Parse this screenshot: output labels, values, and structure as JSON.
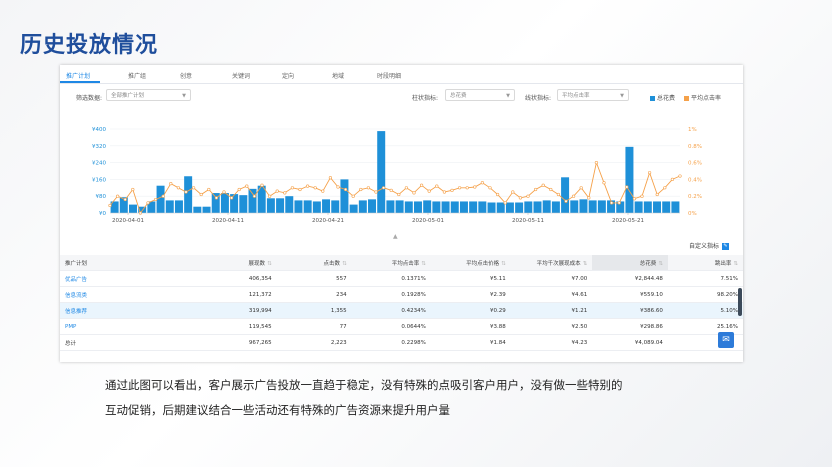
{
  "slide_title": "历史投放情况",
  "tabs": [
    "推广计划",
    "推广组",
    "创意",
    "关键词",
    "定向",
    "地域",
    "时段明细"
  ],
  "filters": {
    "filter_label": "筛选数据:",
    "filter_value": "全部推广计划",
    "bar_metric_label": "柱状指标:",
    "bar_metric_value": "总花费",
    "line_metric_label": "线状指标:",
    "line_metric_value": "平均点击率"
  },
  "legend": [
    {
      "label": "总花费",
      "color": "#1e90d8"
    },
    {
      "label": "平均点击率",
      "color": "#f5a14a"
    }
  ],
  "chart_data": {
    "type": "bar",
    "left_axis_ticks": [
      "¥400",
      "¥320",
      "¥240",
      "¥160",
      "¥80",
      "¥0"
    ],
    "right_axis_ticks": [
      "1%",
      "0.8%",
      "0.6%",
      "0.4%",
      "0.2%",
      "0%"
    ],
    "x_tick_labels": [
      "2020-04-01",
      "2020-04-11",
      "2020-04-21",
      "2020-05-01",
      "2020-05-11",
      "2020-05-21"
    ],
    "ylim_left": [
      0,
      400
    ],
    "ylim_right": [
      0,
      1
    ],
    "series": [
      {
        "name": "总花费",
        "type": "bar",
        "color": "#1e90d8",
        "values": [
          55,
          75,
          40,
          30,
          55,
          130,
          60,
          60,
          175,
          30,
          30,
          95,
          95,
          90,
          85,
          115,
          130,
          70,
          70,
          80,
          60,
          60,
          55,
          65,
          60,
          160,
          40,
          60,
          65,
          390,
          60,
          60,
          55,
          55,
          60,
          55,
          55,
          55,
          55,
          55,
          55,
          50,
          50,
          50,
          50,
          55,
          55,
          60,
          55,
          170,
          60,
          65,
          60,
          60,
          60,
          55,
          315,
          55,
          55,
          55,
          55,
          55
        ]
      },
      {
        "name": "平均点击率",
        "type": "line",
        "color": "#f5a14a",
        "values": [
          0.09,
          0.2,
          0.16,
          0.28,
          0.0,
          0.12,
          0.16,
          0.2,
          0.35,
          0.3,
          0.25,
          0.3,
          0.22,
          0.28,
          0.18,
          0.25,
          0.18,
          0.28,
          0.32,
          0.2,
          0.33,
          0.2,
          0.26,
          0.24,
          0.3,
          0.28,
          0.32,
          0.3,
          0.26,
          0.42,
          0.31,
          0.28,
          0.2,
          0.28,
          0.3,
          0.25,
          0.3,
          0.27,
          0.22,
          0.3,
          0.24,
          0.33,
          0.26,
          0.32,
          0.25,
          0.27,
          0.3,
          0.3,
          0.31,
          0.36,
          0.3,
          0.22,
          0.12,
          0.25,
          0.18,
          0.2,
          0.28,
          0.33,
          0.28,
          0.22,
          0.14,
          0.2,
          0.3,
          0.18,
          0.6,
          0.36,
          0.12,
          0.12,
          0.31,
          0.17,
          0.2,
          0.48,
          0.22,
          0.3,
          0.4,
          0.44
        ]
      }
    ]
  },
  "custom_metric_label": "自定义指标",
  "table": {
    "columns": [
      "推广计划",
      "展现数",
      "点击数",
      "平均点击率",
      "平均点击价格",
      "平均千次展现成本",
      "总花费",
      "跳出率"
    ],
    "rows": [
      [
        "优品广告",
        "406,354",
        "557",
        "0.1371%",
        "¥5.11",
        "¥7.00",
        "¥2,844.48",
        "7.51%"
      ],
      [
        "信息流类",
        "121,372",
        "234",
        "0.1928%",
        "¥2.39",
        "¥4.61",
        "¥559.10",
        "98.20%"
      ],
      [
        "信息推荐",
        "319,994",
        "1,355",
        "0.4234%",
        "¥0.29",
        "¥1.21",
        "¥386.60",
        "5.10%"
      ],
      [
        "PMP",
        "119,545",
        "77",
        "0.0644%",
        "¥3.88",
        "¥2.50",
        "¥298.86",
        "25.16%"
      ],
      [
        "总计",
        "967,265",
        "2,223",
        "0.2298%",
        "¥1.84",
        "¥4.23",
        "¥4,089.04",
        ""
      ]
    ]
  },
  "caption_lines": [
    "通过此图可以看出，客户展示广告投放一直趋于稳定，没有特殊的点吸引客户用户，没有做一些特别的",
    "互动促销，后期建议结合一些活动还有特殊的广告资源来提升用户量"
  ]
}
